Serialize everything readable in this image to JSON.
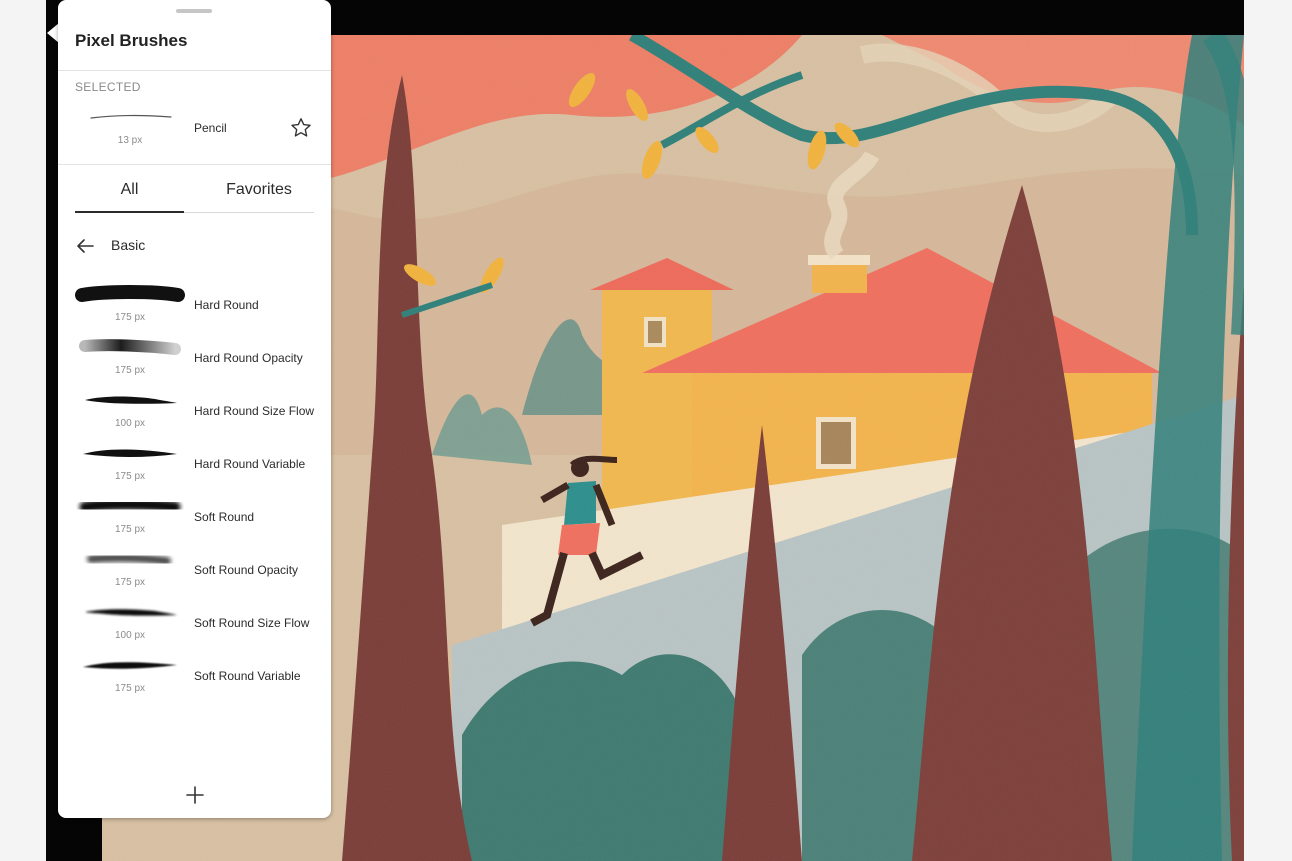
{
  "panel": {
    "title": "Pixel Brushes",
    "selected_label": "SELECTED",
    "selected_brush": {
      "name": "Pencil",
      "size": "13 px"
    },
    "tabs": [
      {
        "label": "All",
        "active": true
      },
      {
        "label": "Favorites",
        "active": false
      }
    ],
    "section": "Basic",
    "brushes": [
      {
        "name": "Hard Round",
        "size": "175 px"
      },
      {
        "name": "Hard Round Opacity",
        "size": "175 px"
      },
      {
        "name": "Hard Round Size Flow",
        "size": "100 px"
      },
      {
        "name": "Hard Round Variable",
        "size": "175 px"
      },
      {
        "name": "Soft Round",
        "size": "175 px"
      },
      {
        "name": "Soft Round Opacity",
        "size": "175 px"
      },
      {
        "name": "Soft Round Size Flow",
        "size": "100 px"
      },
      {
        "name": "Soft Round Variable",
        "size": "175 px"
      }
    ],
    "icons": {
      "favorite": "star-icon",
      "back": "arrow-left-icon",
      "add": "plus-icon"
    }
  },
  "colors": {
    "panel_bg": "#ffffff",
    "text": "#2b2b2b",
    "muted": "#8b8b8b",
    "frame": "#050505"
  }
}
